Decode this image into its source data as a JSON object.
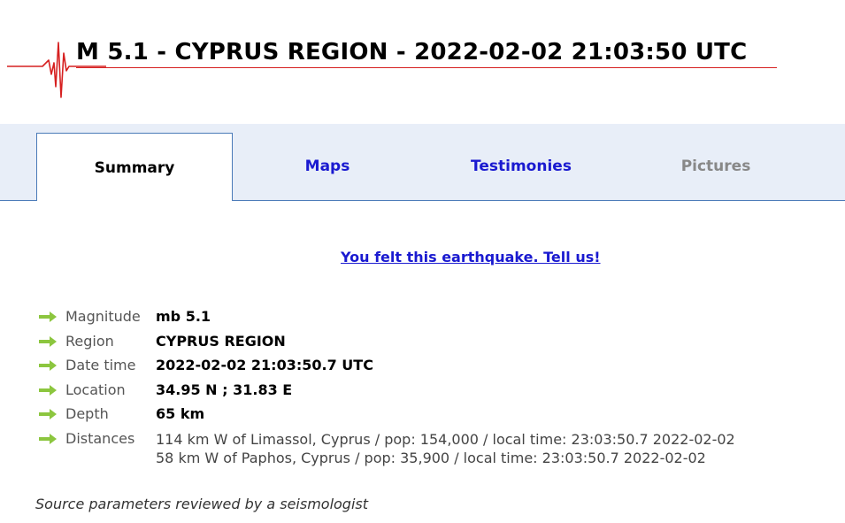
{
  "header": {
    "title": "M 5.1 - CYPRUS REGION - 2022-02-02 21:03:50 UTC",
    "logo_icon": "seismogram-icon"
  },
  "tabs": [
    {
      "label": "Summary",
      "state": "active"
    },
    {
      "label": "Maps",
      "state": "link"
    },
    {
      "label": "Testimonies",
      "state": "link"
    },
    {
      "label": "Pictures",
      "state": "disabled"
    }
  ],
  "felt_link": "You felt this earthquake. Tell us!",
  "params": [
    {
      "label": "Magnitude",
      "value": "mb 5.1"
    },
    {
      "label": "Region",
      "value": "CYPRUS REGION"
    },
    {
      "label": "Date time",
      "value": "2022-02-02 21:03:50.7 UTC"
    },
    {
      "label": "Location",
      "value": "34.95 N ; 31.83 E"
    },
    {
      "label": "Depth",
      "value": "65 km"
    }
  ],
  "distances": {
    "label": "Distances",
    "lines": [
      "114 km W of Limassol, Cyprus / pop: 154,000 / local time: 23:03:50.7 2022-02-02",
      "58 km W of Paphos, Cyprus / pop: 35,900 / local time: 23:03:50.7 2022-02-02"
    ]
  },
  "source_note": "Source parameters reviewed by a seismologist",
  "colors": {
    "accent_red": "#d62020",
    "tab_bar_bg": "#e8eef8",
    "link_blue": "#1a1ad0",
    "arrow_green": "#8cc63f"
  }
}
